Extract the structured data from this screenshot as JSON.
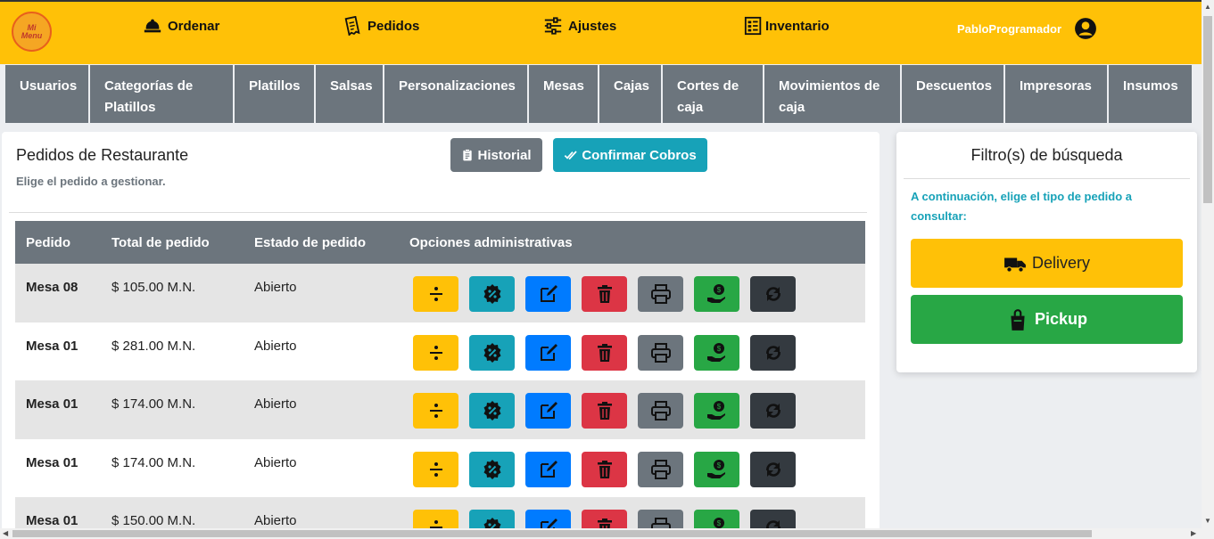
{
  "header": {
    "logo_text": "Mi\nMenu",
    "nav": [
      {
        "label": "Ordenar",
        "icon": "bell-icon"
      },
      {
        "label": "Pedidos",
        "icon": "receipt-icon"
      },
      {
        "label": "Ajustes",
        "icon": "sliders-icon"
      },
      {
        "label": "Inventario",
        "icon": "inventory-icon"
      }
    ],
    "user": {
      "name": "PabloProgramador",
      "icon": "user-circle-icon"
    }
  },
  "subnav": [
    "Usuarios",
    "Categorías de Platillos",
    "Platillos",
    "Salsas",
    "Personalizaciones",
    "Mesas",
    "Cajas",
    "Cortes de caja",
    "Movimientos de caja",
    "Descuentos",
    "Impresoras",
    "Insumos"
  ],
  "main": {
    "title": "Pedidos de Restaurante",
    "subtitle": "Elige el pedido a gestionar.",
    "historial_label": "Historial",
    "confirmar_label": "Confirmar Cobros",
    "columns": [
      "Pedido",
      "Total de pedido",
      "Estado de pedido",
      "Opciones administrativas"
    ],
    "rows": [
      {
        "pedido": "Mesa 08",
        "total": "$ 105.00 M.N.",
        "estado": "Abierto"
      },
      {
        "pedido": "Mesa 01",
        "total": "$ 281.00 M.N.",
        "estado": "Abierto"
      },
      {
        "pedido": "Mesa 01",
        "total": "$ 174.00 M.N.",
        "estado": "Abierto"
      },
      {
        "pedido": "Mesa 01",
        "total": "$ 174.00 M.N.",
        "estado": "Abierto"
      },
      {
        "pedido": "Mesa 01",
        "total": "$ 150.00 M.N.",
        "estado": "Abierto"
      }
    ],
    "actions": [
      {
        "name": "divide-icon",
        "color": "#ffc107"
      },
      {
        "name": "discount-icon",
        "color": "#17a2b8"
      },
      {
        "name": "edit-icon",
        "color": "#007bff"
      },
      {
        "name": "trash-icon",
        "color": "#dc3545"
      },
      {
        "name": "print-icon",
        "color": "#6c757d"
      },
      {
        "name": "pay-icon",
        "color": "#28a745"
      },
      {
        "name": "transfer-icon",
        "color": "#343a40"
      }
    ]
  },
  "filter": {
    "title": "Filtro(s) de búsqueda",
    "text": "A continuación, elige el tipo de pedido a consultar:",
    "delivery_label": "Delivery",
    "pickup_label": "Pickup"
  },
  "colors": {
    "brand": "#ffc107",
    "secondary": "#6c757d",
    "info": "#17a2b8",
    "success": "#28a745"
  }
}
